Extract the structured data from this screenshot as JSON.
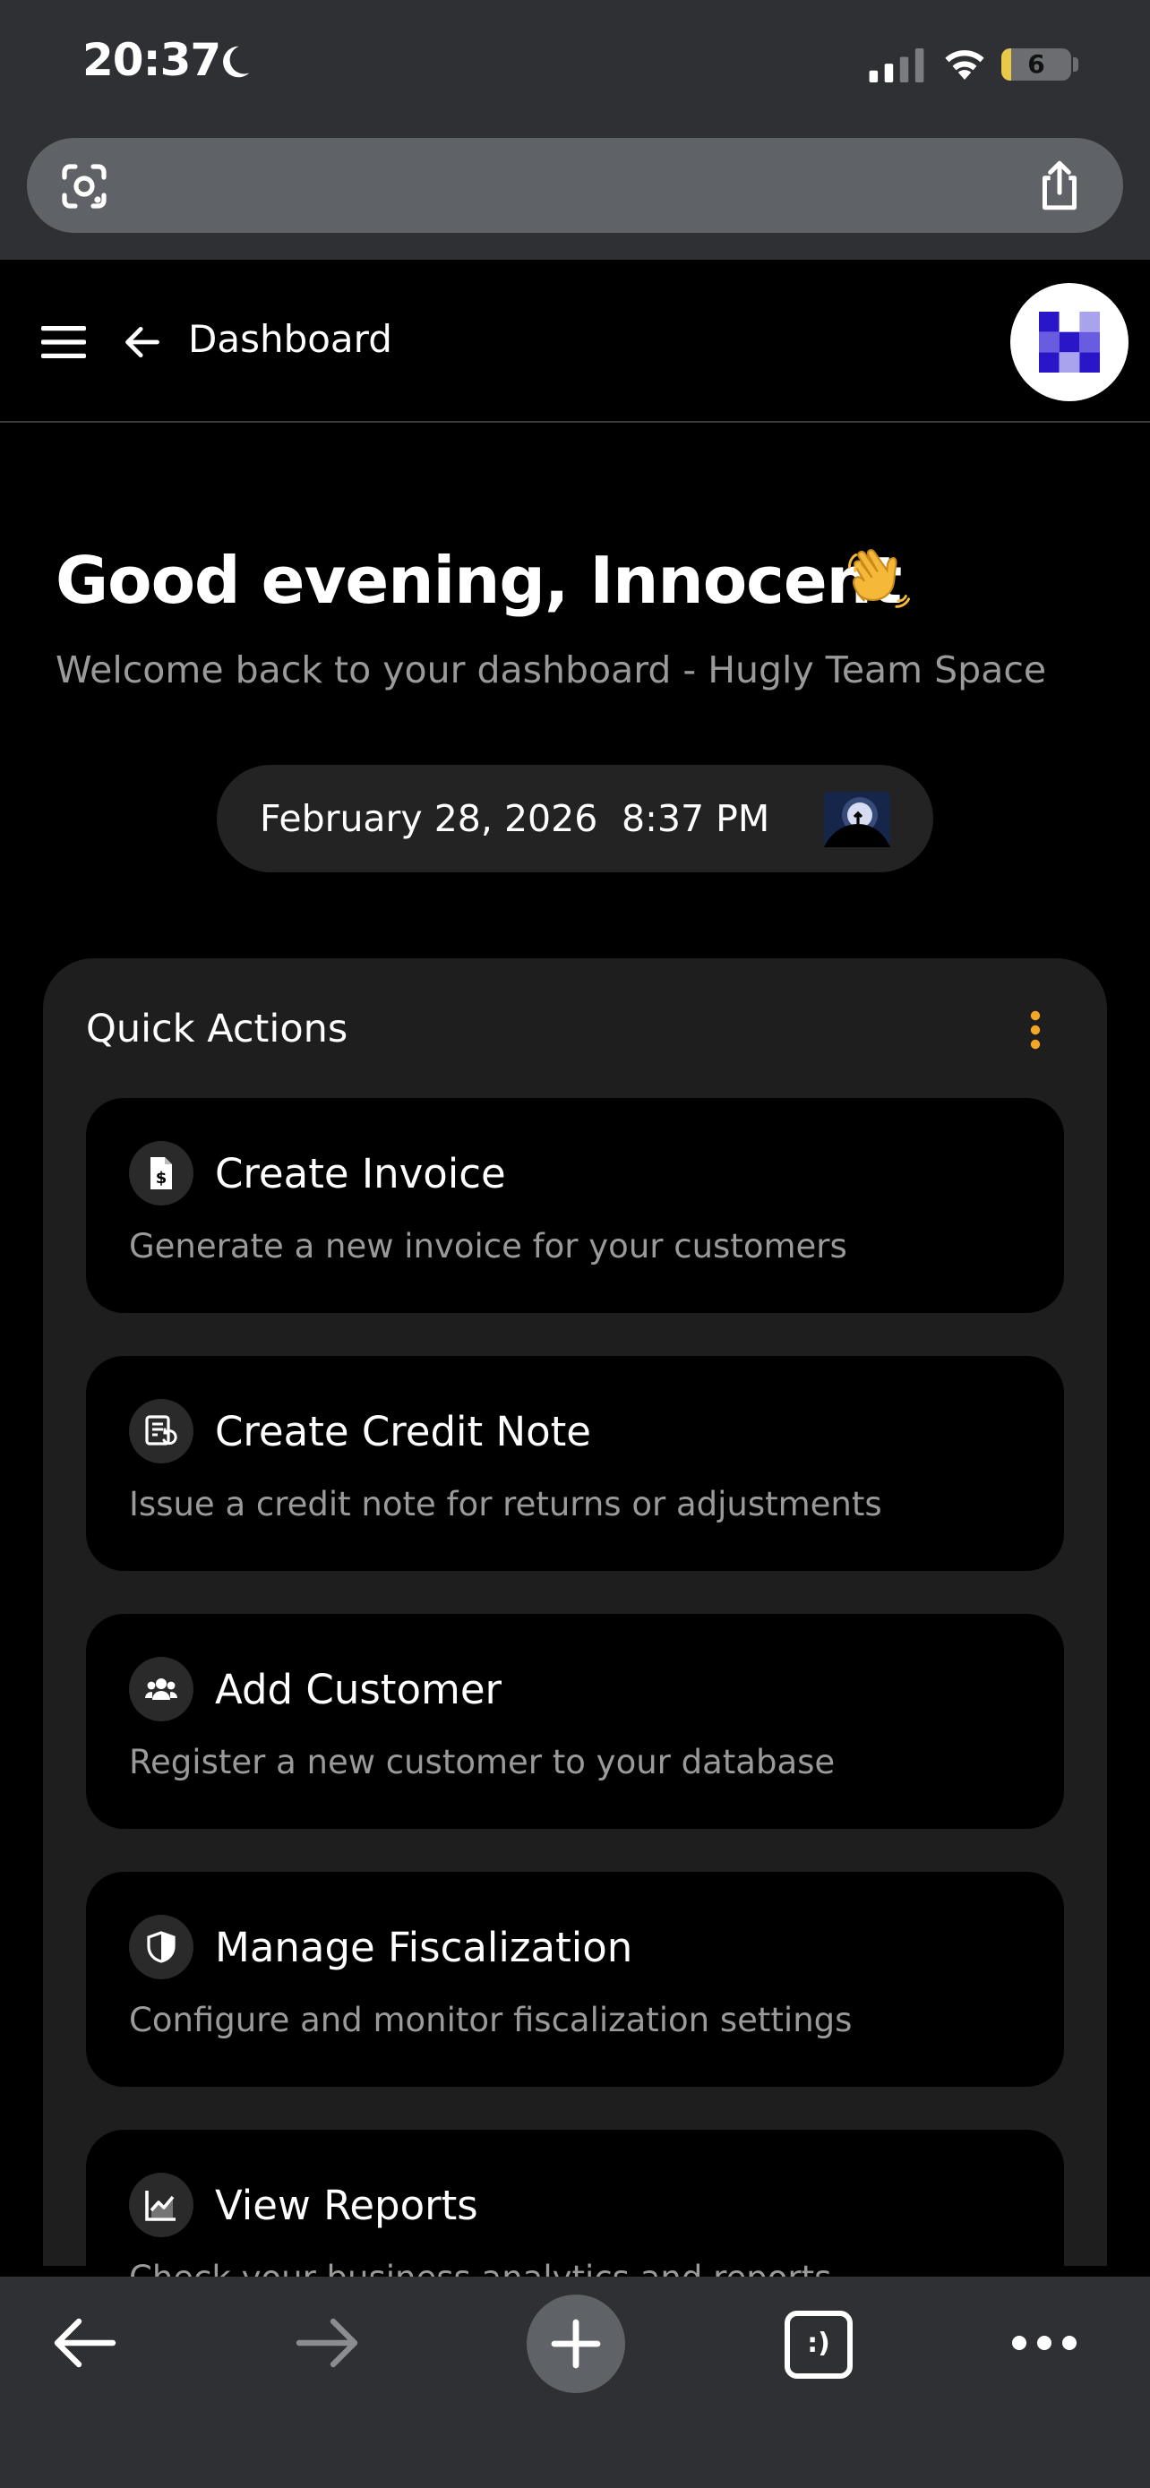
{
  "status_bar": {
    "time": "20:37",
    "battery_level": "6"
  },
  "header": {
    "title": "Dashboard"
  },
  "greeting": {
    "headline": "Good evening, Innocent",
    "subtitle": "Welcome back to your dashboard - Hugly Team Space"
  },
  "datetime": {
    "date": "February 28, 2026",
    "time": "8:37 PM"
  },
  "quick_actions": {
    "title": "Quick Actions",
    "items": [
      {
        "title": "Create Invoice",
        "description": "Generate a new invoice for your customers",
        "icon": "invoice-icon"
      },
      {
        "title": "Create Credit Note",
        "description": "Issue a credit note for returns or adjustments",
        "icon": "credit-note-icon"
      },
      {
        "title": "Add Customer",
        "description": "Register a new customer to your database",
        "icon": "customers-icon"
      },
      {
        "title": "Manage Fiscalization",
        "description": "Configure and monitor fiscalization settings",
        "icon": "shield-icon"
      },
      {
        "title": "View Reports",
        "description": "Check your business analytics and reports",
        "icon": "chart-icon"
      }
    ]
  },
  "toolbar": {
    "tabs_label": ":)"
  },
  "colors": {
    "accent": "#f5a623",
    "background": "#000000",
    "panel": "#1e1e1e",
    "chrome": "#2e3033",
    "muted_text": "#9a9a9a"
  }
}
